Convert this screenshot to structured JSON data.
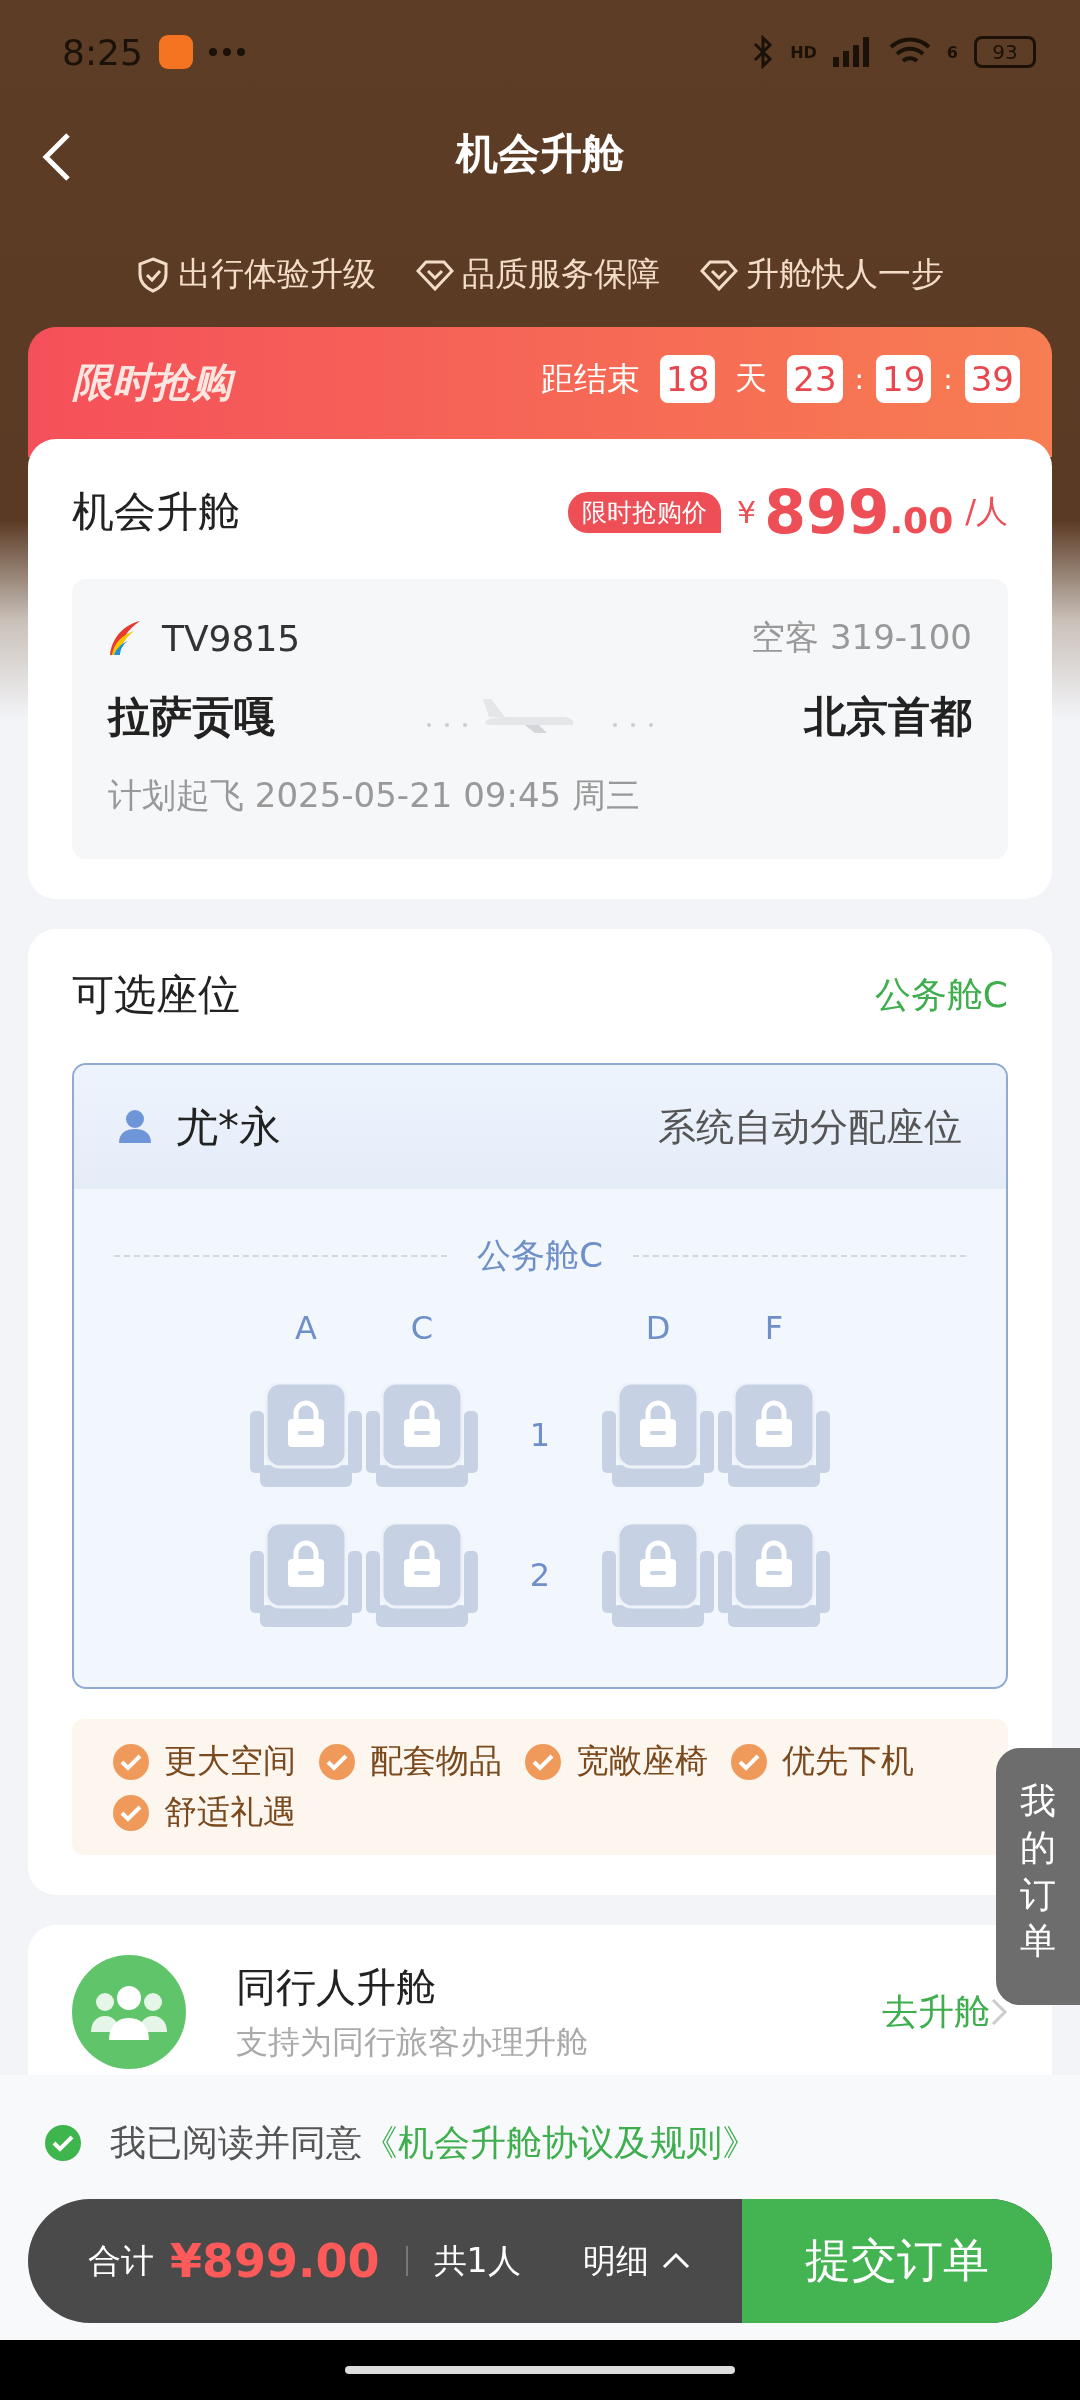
{
  "status_bar": {
    "time": "8:25",
    "network": "HD",
    "wifi": "6",
    "battery": "93"
  },
  "header": {
    "title": "机会升舱"
  },
  "features": [
    {
      "kind": "shield",
      "label": "出行体验升级"
    },
    {
      "kind": "diamond",
      "label": "品质服务保障"
    },
    {
      "kind": "diamond",
      "label": "升舱快人一步"
    }
  ],
  "promo": {
    "title": "限时抢购",
    "countdown_label": "距结束",
    "countdown": [
      {
        "kind": "box",
        "text": "18"
      },
      {
        "kind": "text",
        "text": "天"
      },
      {
        "kind": "box",
        "text": "23"
      },
      {
        "kind": "sep",
        "text": ":"
      },
      {
        "kind": "box",
        "text": "19"
      },
      {
        "kind": "sep",
        "text": ":"
      },
      {
        "kind": "box",
        "text": "39"
      }
    ]
  },
  "upgrade": {
    "title": "机会升舱",
    "price_tag": "限时抢购价",
    "currency": "¥",
    "price_int": "899",
    "price_dec": ".00",
    "per": "/人"
  },
  "flight": {
    "number": "TV9815",
    "aircraft": "空客 319-100",
    "from": "拉萨贡嘎",
    "to": "北京首都",
    "departure": "计划起飞 2025-05-21 09:45 周三"
  },
  "seats": {
    "title": "可选座位",
    "cabin": "公务舱C",
    "passenger": "尤*永",
    "assign_note": "系统自动分配座位",
    "cabin_label": "公务舱C",
    "columns": [
      "A",
      "C",
      "D",
      "F"
    ],
    "rows": [
      {
        "number": "1",
        "seats": [
          {
            "locked": true
          },
          {
            "locked": true
          },
          {
            "locked": true
          },
          {
            "locked": true
          }
        ]
      },
      {
        "number": "2",
        "seats": [
          {
            "locked": true
          },
          {
            "locked": true
          },
          {
            "locked": true
          },
          {
            "locked": true
          }
        ]
      }
    ]
  },
  "benefits": [
    "更大空间",
    "配套物品",
    "宽敞座椅",
    "优先下机",
    "舒适礼遇"
  ],
  "companion": {
    "title": "同行人升舱",
    "subtitle": "支持为同行旅客办理升舱",
    "action": "去升舱"
  },
  "side_tab": {
    "label": "我的订单"
  },
  "agreement": {
    "checked": true,
    "text": "我已阅读并同意",
    "link": "《机会升舱协议及规则》"
  },
  "footer": {
    "total_label": "合计",
    "total": "¥899.00",
    "count": "共1人",
    "detail": "明细",
    "submit": "提交订单"
  }
}
